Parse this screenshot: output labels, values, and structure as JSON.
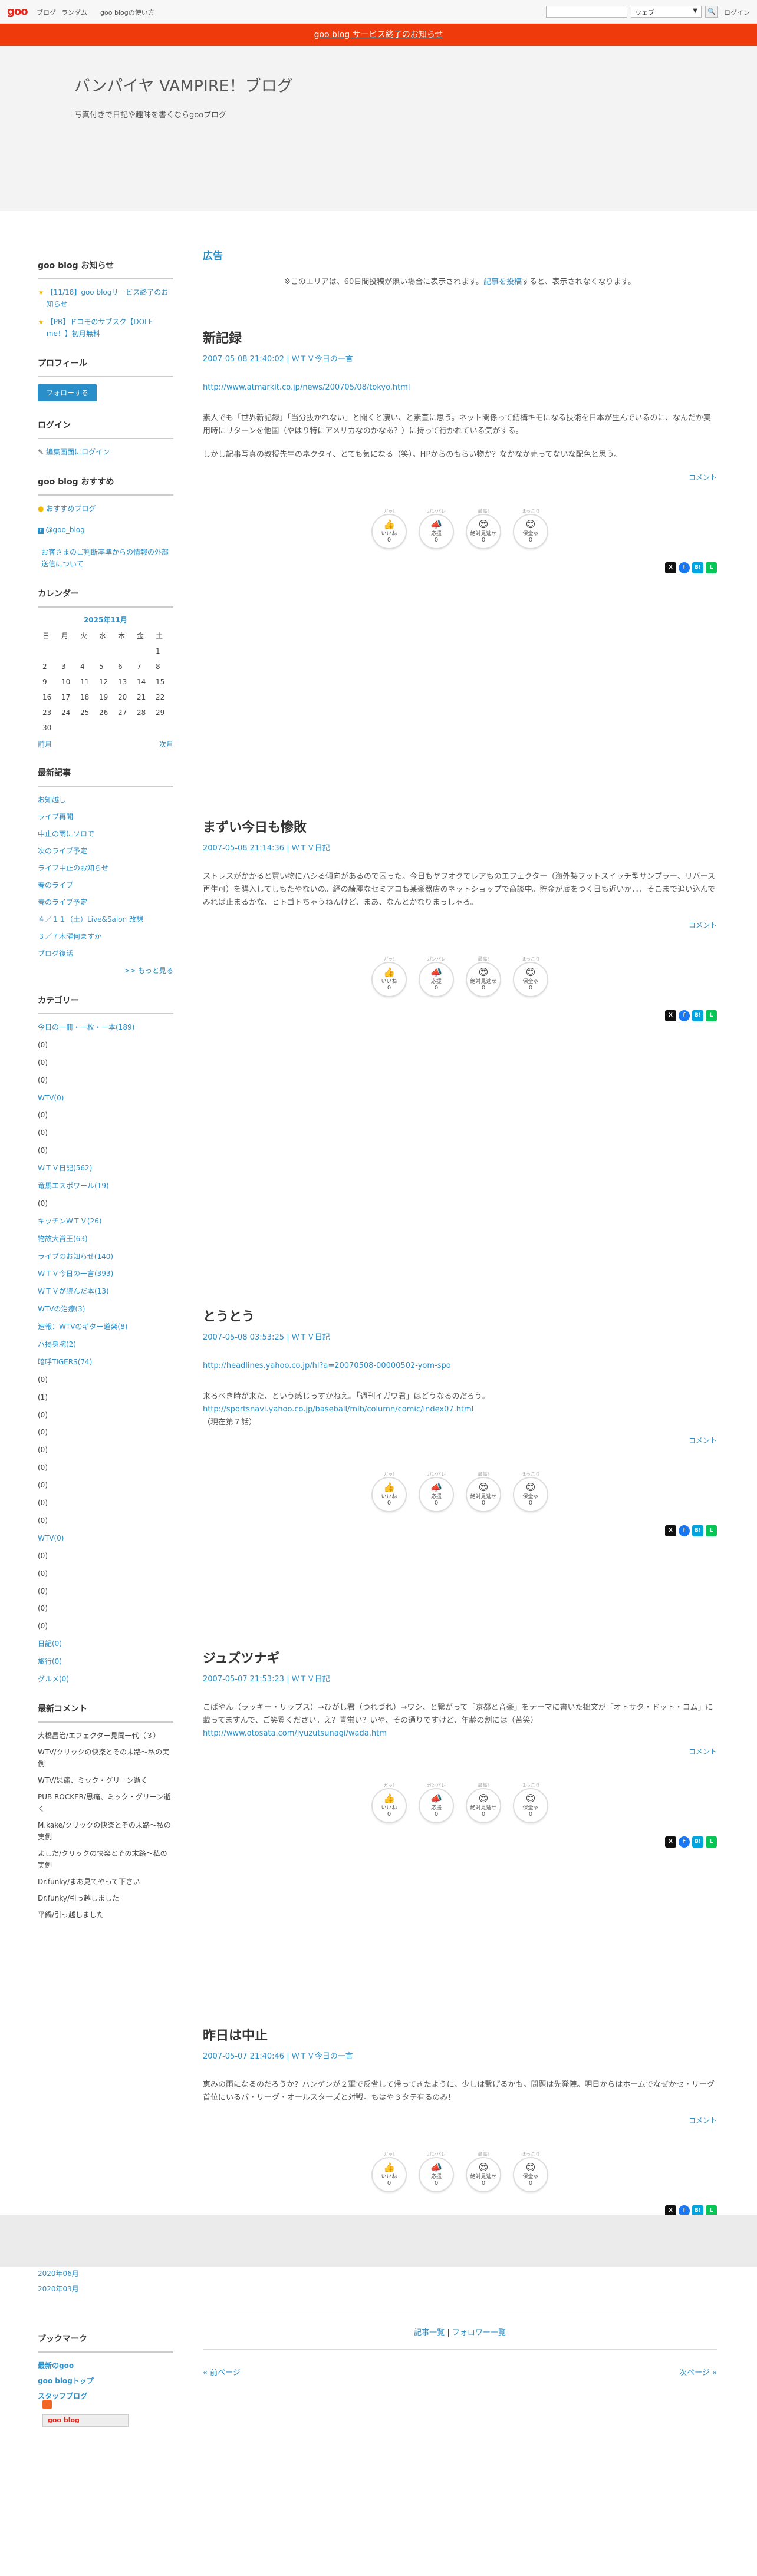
{
  "topbar": {
    "logo": "goo",
    "nav": [
      "ブログ",
      "ランダム",
      "goo blogの使い方"
    ],
    "search_select": "ウェブ",
    "search_btn": "🔍",
    "login": "ログイン"
  },
  "notice": "goo blog サービス終了のお知らせ",
  "header": {
    "title": "バンパイヤ VAMPIRE！ブログ",
    "description": "写真付きで日記や趣味を書くならgooブログ"
  },
  "sidebar": {
    "news_heading": "goo blog お知らせ",
    "news": [
      "【11/18】goo blogサービス終了のお知らせ",
      "【PR】ドコモのサブスク【DOLF me！】初月無料"
    ],
    "profile_heading": "プロフィール",
    "follow": "フォローする",
    "login_heading": "ログイン",
    "login_link": "編集画面にログイン",
    "recommend_heading": "goo blog おすすめ",
    "recommend": [
      "おすすめブログ",
      "@goo_blog",
      "お客さまのご判断基準からの情報の外部送信について"
    ],
    "calendar_heading": "カレンダー",
    "calendar_month": "2025年11月",
    "calendar_weekdays": [
      "日",
      "月",
      "火",
      "水",
      "木",
      "金",
      "土"
    ],
    "calendar_days": [
      "",
      "",
      "",
      "",
      "",
      "",
      "1",
      "2",
      "3",
      "4",
      "5",
      "6",
      "7",
      "8",
      "9",
      "10",
      "11",
      "12",
      "13",
      "14",
      "15",
      "16",
      "17",
      "18",
      "19",
      "20",
      "21",
      "22",
      "23",
      "24",
      "25",
      "26",
      "27",
      "28",
      "29",
      "30",
      "",
      "",
      "",
      "",
      "",
      ""
    ],
    "calendar_prev": "前月",
    "calendar_next": "次月",
    "recent_heading": "最新記事",
    "recent": [
      "お知越し",
      "ライブ再開",
      "中止の雨にソロで",
      "次のライブ予定",
      "ライブ中止のお知らせ",
      "春のライブ",
      "春のライブ予定",
      "４／１１（土）Live&Salon 改想",
      "３／７木曜何ますか",
      "ブログ復活"
    ],
    "recent_more": ">> もっと見る",
    "category_heading": "カテゴリー",
    "categories": [
      "今日の一冊・一枚・一本(189)",
      "(0)",
      "(0)",
      "(0)",
      "WTV(0)",
      "(0)",
      "(0)",
      "(0)",
      "ＷＴＶ日記(562)",
      "竜馬エスポワール(19)",
      "(0)",
      "キッチンWＴＶ(26)",
      "物故大賞王(63)",
      "ライブのお知らせ(140)",
      "ＷＴＶ今日の一言(393)",
      "ＷＴＶが読んだ本(13)",
      "WTVの治療(3)",
      "速報：WTVのギター道楽(8)",
      "ハ掲身腕(2)",
      "暗呼TIGERS(74)",
      "(0)",
      "(1)",
      "(0)",
      "(0)",
      "(0)",
      "(0)",
      "(0)",
      "(0)",
      "(0)",
      "WTV(0)",
      "(0)",
      "(0)",
      "(0)",
      "(0)",
      "(0)",
      "日記(0)",
      "旅行(0)",
      "グルメ(0)"
    ],
    "comments_heading": "最新コメント",
    "comments": [
      "大橋昌治/エフェクター見聞一代（３）",
      "WTV/クリックの快楽とその末路〜私の実例",
      "WTV/思痛、ミック・グリーン逝く",
      "PUB ROCKER/思痛、ミック・グリーン逝く",
      "M.kake/クリックの快楽とその末路〜私の実例",
      "よしだ/クリックの快楽とその末路〜私の実例",
      "Dr.funky/まあ見てやって下さい",
      "Dr.funky/引っ越しました",
      "平鍋/引っ越しました"
    ]
  },
  "main": {
    "ad_heading": "広告",
    "ad_note_pre": "※このエリアは、60日間投稿が無い場合に表示されます。",
    "ad_note_link": "記事を投稿",
    "ad_note_post": "すると、表示されなくなります。",
    "reaction_labels": [
      "いいね",
      "応援",
      "絶対見逃せ",
      "保全ゃ"
    ],
    "reaction_tags": [
      "ガッ!",
      "ガンバレ",
      "最高!",
      "ほっこり"
    ],
    "comment_label": "コメント",
    "entries": [
      {
        "title": "新記録",
        "date": "2007-05-08 21:40:02",
        "category": "ＷＴＶ今日の一言",
        "link": "http://www.atmarkit.co.jp/news/200705/08/tokyo.html",
        "paragraphs": [
          "素人でも「世界新記録」「当分抜かれない」と聞くと凄い、と素直に思う。ネット関係って結構キモになる技術を日本が生んでいるのに、なんだか実用時にリターンを他国（やはり特にアメリカなのかなあ？）に持って行かれている気がする。",
          "しかし記事写真の教授先生のネクタイ、とても気になる（笑）。HPからのもらい物か？なかなか売ってないな配色と思う。"
        ]
      },
      {
        "title": "まずい今日も惨敗",
        "date": "2007-05-08 21:14:36",
        "category": "ＷＴＶ日記",
        "link": "",
        "paragraphs": [
          "ストレスがかかると買い物にハシる傾向があるので困った。今日もヤフオクでレアものエフェクター（海外製フットスイッチ型サンプラー、リバース再生可）を購入してしもたやないの。経の綺麗なセミアコも某楽器店のネットショップで商談中。貯金が底をつく日も近いか．．．そこまで追い込んでみれば止まるかな、ヒトゴトちゃうねんけど、まあ、なんとかなりまっしゃろ。"
        ]
      },
      {
        "title": "とうとう",
        "date": "2007-05-08 03:53:25",
        "category": "ＷＴＶ日記",
        "link": "http://headlines.yahoo.co.jp/hl?a=20070508-00000502-yom-spo",
        "paragraphs": [
          "来るべき時が来た、という感じっすかねえ。「週刊イガワ君」はどうなるのだろう。"
        ],
        "link2": "http://sportsnavi.yahoo.co.jp/baseball/mlb/column/comic/index07.html",
        "note": "（現在第７話）"
      },
      {
        "title": "ジュズツナギ",
        "date": "2007-05-07 21:53:23",
        "category": "ＷＴＶ日記",
        "link": "",
        "paragraphs": [
          "こばやん（ラッキー・リップス）→ひがし君（つれづれ）→ワシ、と繋がって「京都と音楽」をテーマに書いた拙文が「オトサタ・ドット・コム」に載ってますんで、ご笑覧ください。え？青蛍い？いや、その通りですけど、年齢の割には（苦笑）"
        ],
        "link2": "http://www.otosata.com/jyuzutsunagi/wada.htm"
      },
      {
        "title": "昨日は中止",
        "date": "2007-05-07 21:40:46",
        "category": "ＷＴＶ今日の一言",
        "link": "",
        "paragraphs": [
          "恵みの雨になるのだろうか？ハンゲンが２軍で反省して帰ってきたように、少しは繋げるかも。問題は先発陣。明日からはホームでなぜかセ・リーグ首位にいるパ・リーグ・オールスターズと対戦。もはや３タテ有るのみ！"
        ]
      }
    ],
    "pager_top_left": "記事一覧",
    "pager_top_right": "フォロワー一覧",
    "prev": "« 前ページ",
    "next": "次ページ »"
  },
  "footer": {
    "archives": [
      "2020年06月",
      "2020年03月"
    ],
    "bookmark_heading": "ブックマーク",
    "bookmarks": [
      "最新のgoo",
      "goo blogトップ",
      "スタッフブログ"
    ],
    "badge": "goo blog"
  },
  "colors": {
    "accent": "#2a8fc9",
    "notice": "#ef3a0b",
    "logo": "#e4261b"
  }
}
